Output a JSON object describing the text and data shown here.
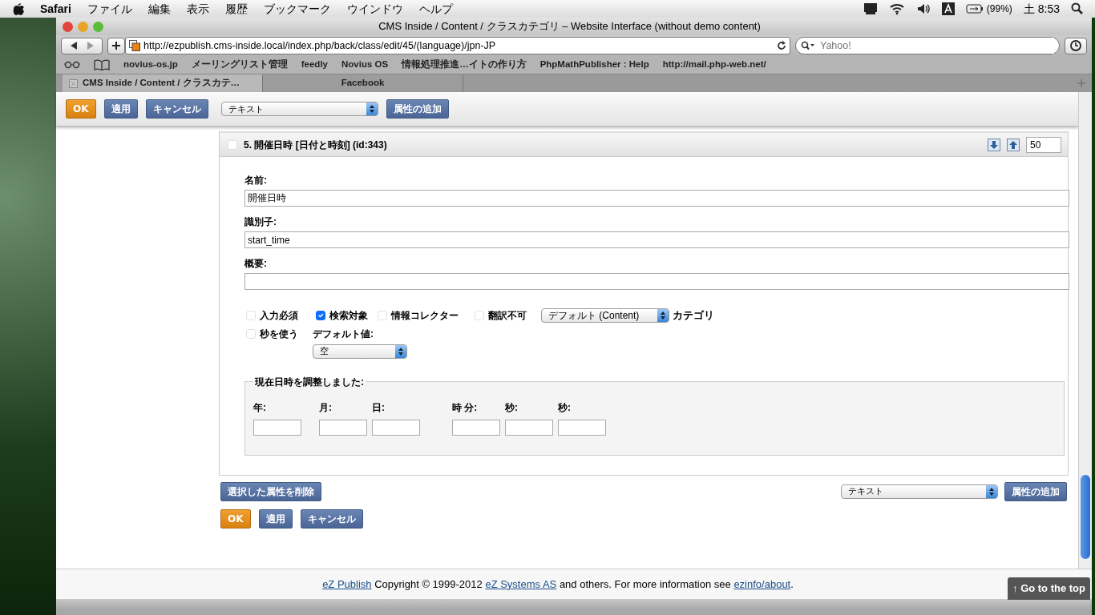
{
  "menubar": {
    "app": "Safari",
    "items": [
      "ファイル",
      "編集",
      "表示",
      "履歴",
      "ブックマーク",
      "ウインドウ",
      "ヘルプ"
    ],
    "battery": "(99%)",
    "clock": "土 8:53"
  },
  "window": {
    "title": "CMS Inside / Content / クラスカテゴリ – Website Interface (without demo content)",
    "url": "http://ezpublish.cms-inside.local/index.php/back/class/edit/45/(language)/jpn-JP",
    "search_placeholder": "Yahoo!",
    "bookmarks": [
      "novius-os.jp",
      "メーリングリスト管理",
      "feedly",
      "Novius OS",
      "情報処理推進…イトの作り方",
      "PhpMathPublisher : Help",
      "http://mail.php-web.net/"
    ],
    "tabs": [
      {
        "label": "CMS Inside / Content / クラスカテ…",
        "selected": true
      },
      {
        "label": "Facebook",
        "selected": false
      }
    ]
  },
  "top_toolbar": {
    "buttons": [
      {
        "label": "OK",
        "kind": "primary"
      },
      {
        "label": "適用",
        "kind": "normal"
      },
      {
        "label": "キャンセル",
        "kind": "normal"
      }
    ],
    "select": "テキスト",
    "add_button": "属性の追加"
  },
  "attribute": {
    "checked": false,
    "title": "5. 開催日時 [日付と時刻] (id:343)",
    "priority": "50",
    "fields": [
      {
        "label": "名前:",
        "value": "開催日時"
      },
      {
        "label": "識別子:",
        "value": "start_time"
      },
      {
        "label": "概要:"
      }
    ],
    "options": [
      {
        "label": "入力必須",
        "checked": false
      },
      {
        "label": "検索対象",
        "checked": true
      },
      {
        "label": "情報コレクター",
        "checked": false
      },
      {
        "label": "翻訳不可",
        "checked": false
      }
    ],
    "category_select": "デフォルト (Content)",
    "category_label": "カテゴリ",
    "seconds": {
      "label": "秒を使う",
      "checked": false
    },
    "default_label": "デフォルト値:",
    "default_select": "空",
    "adjust": {
      "legend": "現在日時を調整しました:",
      "fields": [
        "年:",
        "月:",
        "日:",
        "時 分:",
        "秒:",
        "秒:"
      ]
    }
  },
  "bottom": {
    "remove_button": "選択した属性を削除",
    "select": "テキスト",
    "add_button": "属性の追加",
    "buttons": [
      {
        "label": "OK",
        "kind": "primary"
      },
      {
        "label": "適用",
        "kind": "normal"
      },
      {
        "label": "キャンセル",
        "kind": "normal"
      }
    ]
  },
  "footer": [
    {
      "text": "eZ Publish",
      "kind": "link"
    },
    {
      "text": " Copyright © 1999-2012 ",
      "kind": "text"
    },
    {
      "text": "eZ Systems AS",
      "kind": "link"
    },
    {
      "text": " and others. For more information see ",
      "kind": "text"
    },
    {
      "text": "ezinfo/about",
      "kind": "link"
    },
    {
      "text": ".",
      "kind": "text"
    }
  ],
  "go_top": "↑ Go to the top"
}
